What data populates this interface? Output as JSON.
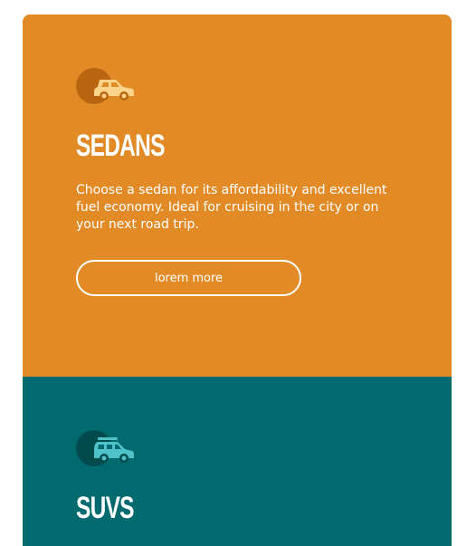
{
  "cards": [
    {
      "title": "SEDANS",
      "description": "Choose a sedan for its affordability and excellent fuel economy. Ideal for cruising in the city or on your next road trip.",
      "button_label": "lorem more",
      "icon": "sedan-car-icon",
      "background_color": "#e28b26",
      "icon_color": "#fbd38a"
    },
    {
      "title": "SUVS",
      "icon": "suv-car-icon",
      "background_color": "#006a6f",
      "icon_color": "#4fc1c8"
    }
  ]
}
